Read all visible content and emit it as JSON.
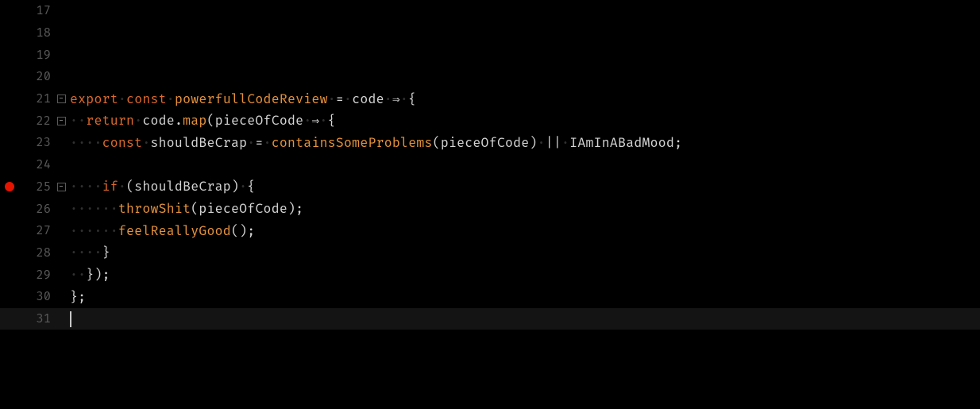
{
  "editor": {
    "lines": [
      {
        "n": 17,
        "fold": "",
        "bp": false,
        "tokens": []
      },
      {
        "n": 18,
        "fold": "",
        "bp": false,
        "tokens": []
      },
      {
        "n": 19,
        "fold": "",
        "bp": false,
        "tokens": []
      },
      {
        "n": 20,
        "fold": "",
        "bp": false,
        "tokens": []
      },
      {
        "n": 21,
        "fold": "minus",
        "bp": false,
        "tokens": [
          {
            "cls": "kw-export",
            "t": "export"
          },
          {
            "cls": "ws",
            "t": "·"
          },
          {
            "cls": "kw-const",
            "t": "const"
          },
          {
            "cls": "ws",
            "t": "·"
          },
          {
            "cls": "fn-decl",
            "t": "powerfullCodeReview"
          },
          {
            "cls": "ws",
            "t": "·"
          },
          {
            "cls": "op",
            "t": "="
          },
          {
            "cls": "ws",
            "t": "·"
          },
          {
            "cls": "ident",
            "t": "code"
          },
          {
            "cls": "ws",
            "t": "·"
          },
          {
            "cls": "arrow",
            "t": "⇒"
          },
          {
            "cls": "ws",
            "t": "·"
          },
          {
            "cls": "brace",
            "t": "{"
          }
        ]
      },
      {
        "n": 22,
        "fold": "minus",
        "bp": false,
        "tokens": [
          {
            "cls": "ws",
            "t": "··"
          },
          {
            "cls": "kw-return",
            "t": "return"
          },
          {
            "cls": "ws",
            "t": "·"
          },
          {
            "cls": "ident",
            "t": "code"
          },
          {
            "cls": "punct",
            "t": "."
          },
          {
            "cls": "method",
            "t": "map"
          },
          {
            "cls": "paren",
            "t": "("
          },
          {
            "cls": "ident",
            "t": "pieceOfCode"
          },
          {
            "cls": "ws",
            "t": "·"
          },
          {
            "cls": "arrow",
            "t": "⇒"
          },
          {
            "cls": "ws",
            "t": "·"
          },
          {
            "cls": "brace",
            "t": "{"
          }
        ]
      },
      {
        "n": 23,
        "fold": "",
        "bp": false,
        "tokens": [
          {
            "cls": "ws",
            "t": "····"
          },
          {
            "cls": "kw-const",
            "t": "const"
          },
          {
            "cls": "ws",
            "t": "·"
          },
          {
            "cls": "ident",
            "t": "shouldBeCrap"
          },
          {
            "cls": "ws",
            "t": "·"
          },
          {
            "cls": "op",
            "t": "="
          },
          {
            "cls": "ws",
            "t": "·"
          },
          {
            "cls": "fn-call",
            "t": "containsSomeProblems"
          },
          {
            "cls": "paren",
            "t": "("
          },
          {
            "cls": "ident",
            "t": "pieceOfCode"
          },
          {
            "cls": "paren",
            "t": ")"
          },
          {
            "cls": "ws",
            "t": "·"
          },
          {
            "cls": "op",
            "t": "||"
          },
          {
            "cls": "ws",
            "t": "·"
          },
          {
            "cls": "ident",
            "t": "IAmInABadMood"
          },
          {
            "cls": "punct",
            "t": ";"
          }
        ]
      },
      {
        "n": 24,
        "fold": "",
        "bp": false,
        "tokens": []
      },
      {
        "n": 25,
        "fold": "minus",
        "bp": true,
        "tokens": [
          {
            "cls": "ws",
            "t": "····"
          },
          {
            "cls": "kw-if",
            "t": "if"
          },
          {
            "cls": "ws",
            "t": "·"
          },
          {
            "cls": "paren",
            "t": "("
          },
          {
            "cls": "ident",
            "t": "shouldBeCrap"
          },
          {
            "cls": "paren",
            "t": ")"
          },
          {
            "cls": "ws",
            "t": "·"
          },
          {
            "cls": "brace",
            "t": "{"
          }
        ]
      },
      {
        "n": 26,
        "fold": "",
        "bp": false,
        "tokens": [
          {
            "cls": "ws",
            "t": "······"
          },
          {
            "cls": "fn-call",
            "t": "throwShit"
          },
          {
            "cls": "paren",
            "t": "("
          },
          {
            "cls": "ident",
            "t": "pieceOfCode"
          },
          {
            "cls": "paren",
            "t": ")"
          },
          {
            "cls": "punct",
            "t": ";"
          }
        ]
      },
      {
        "n": 27,
        "fold": "",
        "bp": false,
        "tokens": [
          {
            "cls": "ws",
            "t": "······"
          },
          {
            "cls": "fn-call",
            "t": "feelReallyGood"
          },
          {
            "cls": "paren",
            "t": "("
          },
          {
            "cls": "paren",
            "t": ")"
          },
          {
            "cls": "punct",
            "t": ";"
          }
        ]
      },
      {
        "n": 28,
        "fold": "",
        "bp": false,
        "tokens": [
          {
            "cls": "ws",
            "t": "····"
          },
          {
            "cls": "brace",
            "t": "}"
          }
        ]
      },
      {
        "n": 29,
        "fold": "",
        "bp": false,
        "tokens": [
          {
            "cls": "ws",
            "t": "··"
          },
          {
            "cls": "brace",
            "t": "}"
          },
          {
            "cls": "paren",
            "t": ")"
          },
          {
            "cls": "punct",
            "t": ";"
          }
        ]
      },
      {
        "n": 30,
        "fold": "",
        "bp": false,
        "tokens": [
          {
            "cls": "brace",
            "t": "}"
          },
          {
            "cls": "punct",
            "t": ";"
          }
        ]
      },
      {
        "n": 31,
        "fold": "",
        "bp": false,
        "current": true,
        "cursor": true,
        "tokens": []
      }
    ],
    "fold_glyph": "⊟"
  }
}
